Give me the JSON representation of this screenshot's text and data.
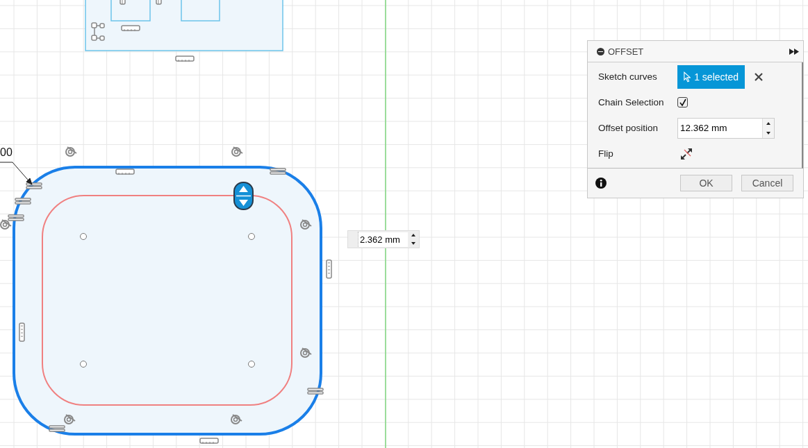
{
  "dimension": {
    "text": "00"
  },
  "offset_input": {
    "value": "2.362 mm"
  },
  "panel": {
    "title": "OFFSET",
    "rows": [
      {
        "kind": "selection",
        "label": "Sketch curves",
        "value": "1 selected"
      },
      {
        "kind": "checkbox",
        "label": "Chain Selection",
        "checked": true
      },
      {
        "kind": "number",
        "label": "Offset position",
        "value": "12.362 mm"
      },
      {
        "kind": "flip",
        "label": "Flip"
      }
    ],
    "buttons": [
      "OK",
      "Cancel"
    ]
  }
}
